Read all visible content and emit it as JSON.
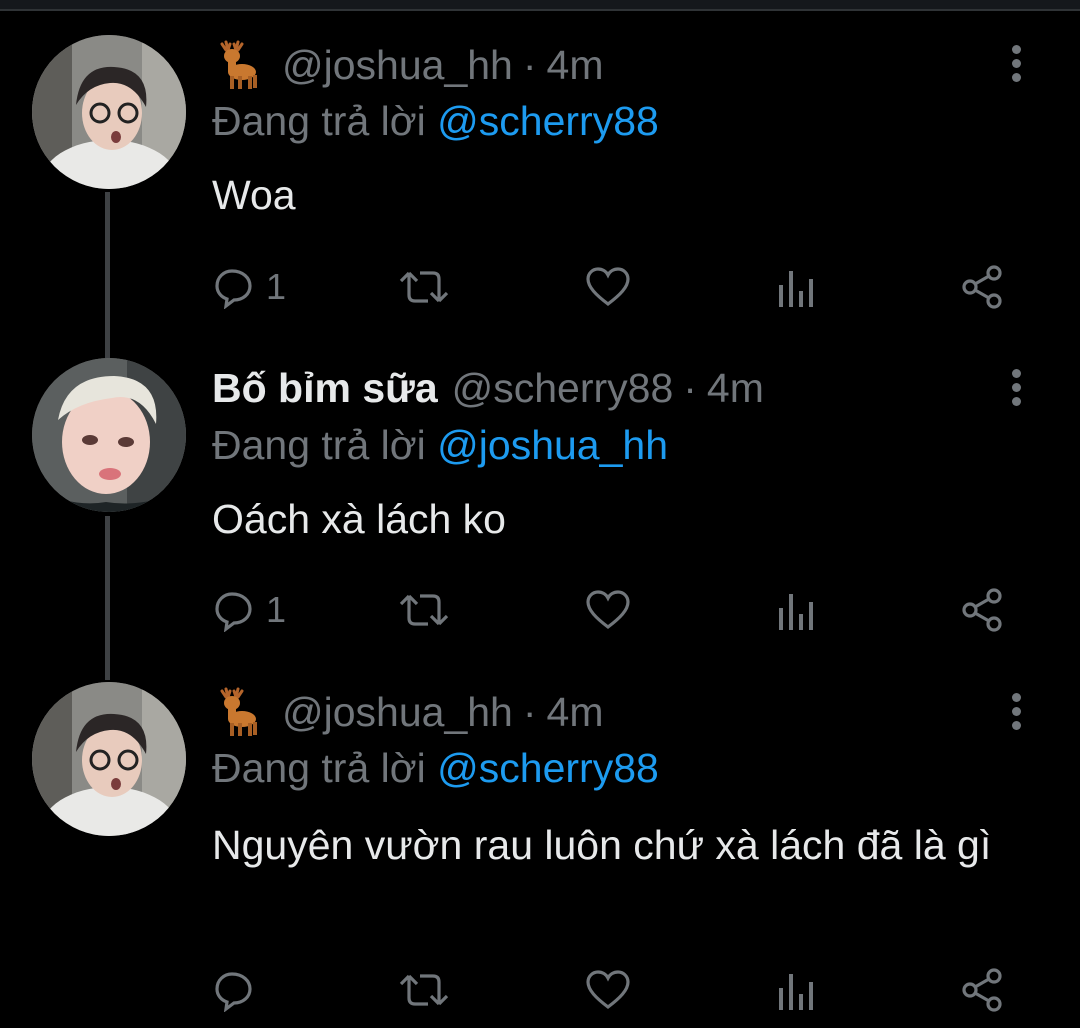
{
  "colors": {
    "background": "#000000",
    "text": "#e7e9ea",
    "muted": "#71767b",
    "accent": "#1d9bf0",
    "thread_line": "#3e4144"
  },
  "tweets": [
    {
      "avatar": "avatar-photo",
      "emoji": "deer-emoji",
      "display_name": "",
      "handle": "@joshua_hh",
      "separator": "·",
      "time": "4m",
      "replying_prefix": "Đang trả lời",
      "replying_to": "@scherry88",
      "text": "Woa",
      "reply_count": "1"
    },
    {
      "avatar": "avatar-photo",
      "display_name": "Bố bỉm sữa",
      "handle": "@scherry88",
      "separator": "·",
      "time": "4m",
      "replying_prefix": "Đang trả lời",
      "replying_to": "@joshua_hh",
      "text": "Oách xà lách ko",
      "reply_count": "1"
    },
    {
      "avatar": "avatar-photo",
      "emoji": "deer-emoji",
      "display_name": "",
      "handle": "@joshua_hh",
      "separator": "·",
      "time": "4m",
      "replying_prefix": "Đang trả lời",
      "replying_to": "@scherry88",
      "text": "Nguyên vườn rau luôn chứ xà lách đã là gì",
      "reply_count": ""
    }
  ],
  "icons": [
    "reply-icon",
    "retweet-icon",
    "like-icon",
    "analytics-icon",
    "share-icon",
    "more-icon"
  ]
}
